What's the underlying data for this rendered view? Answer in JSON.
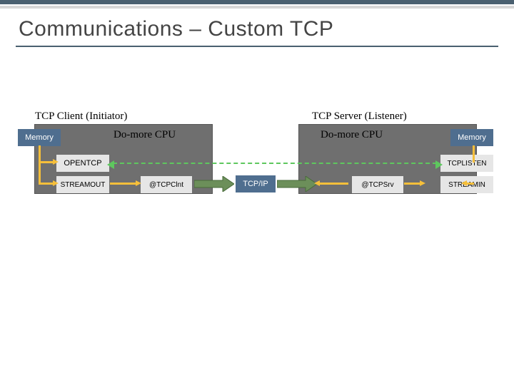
{
  "title": "Communications – Custom TCP",
  "client": {
    "caption": "TCP Client (Initiator)",
    "cpu": "Do-more CPU",
    "memory": "Memory",
    "opentcp": "OPENTCP",
    "streamout": "STREAMOUT",
    "tcpclnt": "@TCPClnt"
  },
  "server": {
    "caption": "TCP Server (Listener)",
    "cpu": "Do-more CPU",
    "memory": "Memory",
    "tcplisten": "TCPLISTEN",
    "streamin": "STREAMIN",
    "tcpsrv": "@TCPSrv"
  },
  "middle": {
    "tcpip": "TCP/IP"
  }
}
